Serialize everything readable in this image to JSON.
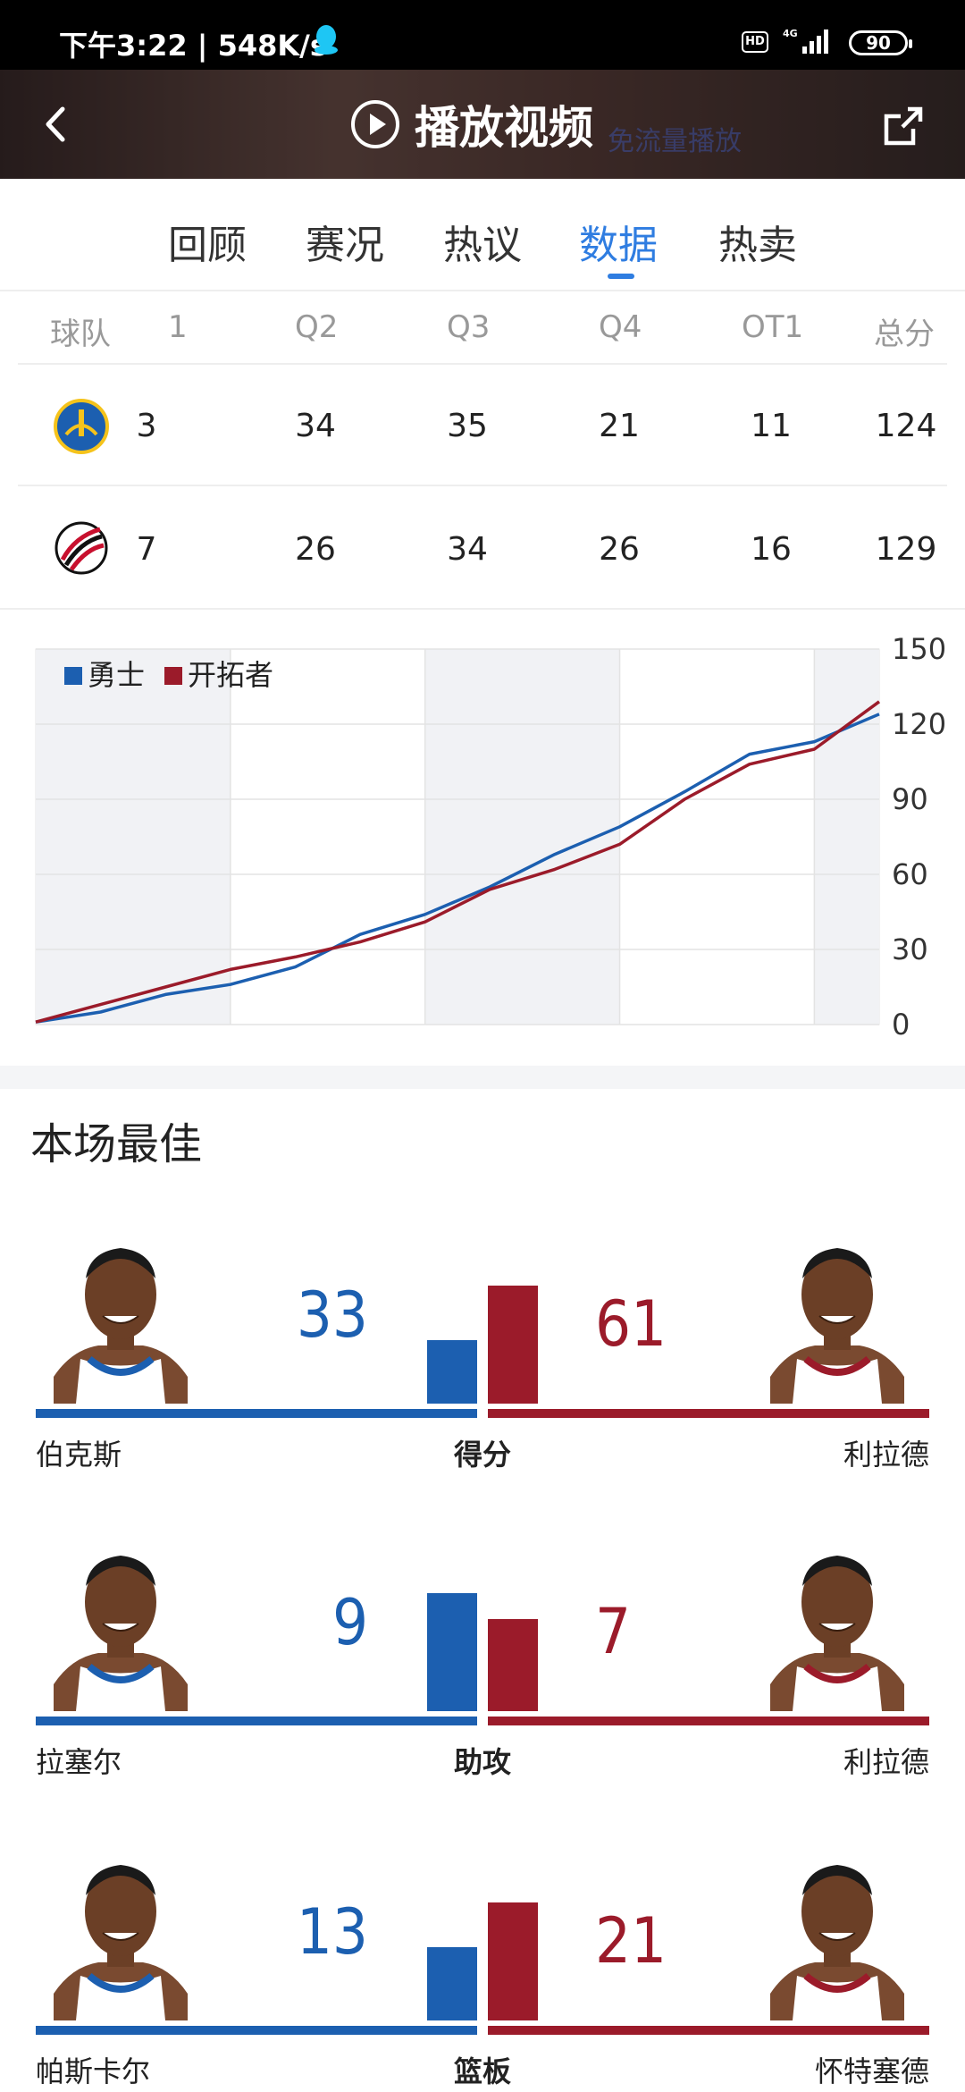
{
  "status_bar": {
    "time": "下午3:22 | 548K/s",
    "hd": "HD",
    "network": "4G",
    "battery": "90"
  },
  "video_header": {
    "title": "播放视频",
    "ghost_text": "免流量播放"
  },
  "tabs": [
    "回顾",
    "赛况",
    "热议",
    "数据",
    "热卖"
  ],
  "active_tab": "数据",
  "score_table": {
    "headers": [
      "球队",
      "1",
      "Q2",
      "Q3",
      "Q4",
      "OT1",
      "总分"
    ],
    "rows": [
      {
        "team": "勇士",
        "values": [
          "3",
          "34",
          "35",
          "21",
          "11",
          "124"
        ]
      },
      {
        "team": "开拓者",
        "values": [
          "7",
          "26",
          "34",
          "26",
          "16",
          "129"
        ]
      }
    ]
  },
  "colors": {
    "warriors": "#1c5fb0",
    "blazers": "#9b1b2a",
    "accent": "#2f7de1"
  },
  "chart_data": {
    "type": "line",
    "title": "",
    "xlabel": "",
    "ylabel": "",
    "ylim": [
      0,
      150
    ],
    "yticks": [
      "150",
      "120",
      "90",
      "60",
      "30",
      "0"
    ],
    "x": [
      0,
      4,
      8,
      12,
      16,
      20,
      24,
      28,
      32,
      36,
      40,
      44,
      48,
      52
    ],
    "series": [
      {
        "name": "勇士",
        "values": [
          1,
          5,
          12,
          16,
          23,
          36,
          44,
          55,
          68,
          79,
          93,
          108,
          113,
          124
        ]
      },
      {
        "name": "开拓者",
        "values": [
          1,
          8,
          15,
          22,
          27,
          33,
          41,
          54,
          62,
          72,
          90,
          104,
          110,
          129
        ]
      }
    ],
    "legend": "top-left",
    "shaded_quarters": [
      1,
      3,
      5
    ]
  },
  "best": {
    "title": "本场最佳",
    "stats": [
      {
        "label": "得分",
        "left_name": "伯克斯",
        "left_value": 33,
        "right_name": "利拉德",
        "right_value": 61
      },
      {
        "label": "助攻",
        "left_name": "拉塞尔",
        "left_value": 9,
        "right_name": "利拉德",
        "right_value": 7
      },
      {
        "label": "篮板",
        "left_name": "帕斯卡尔",
        "left_value": 13,
        "right_name": "怀特塞德",
        "right_value": 21
      }
    ]
  }
}
